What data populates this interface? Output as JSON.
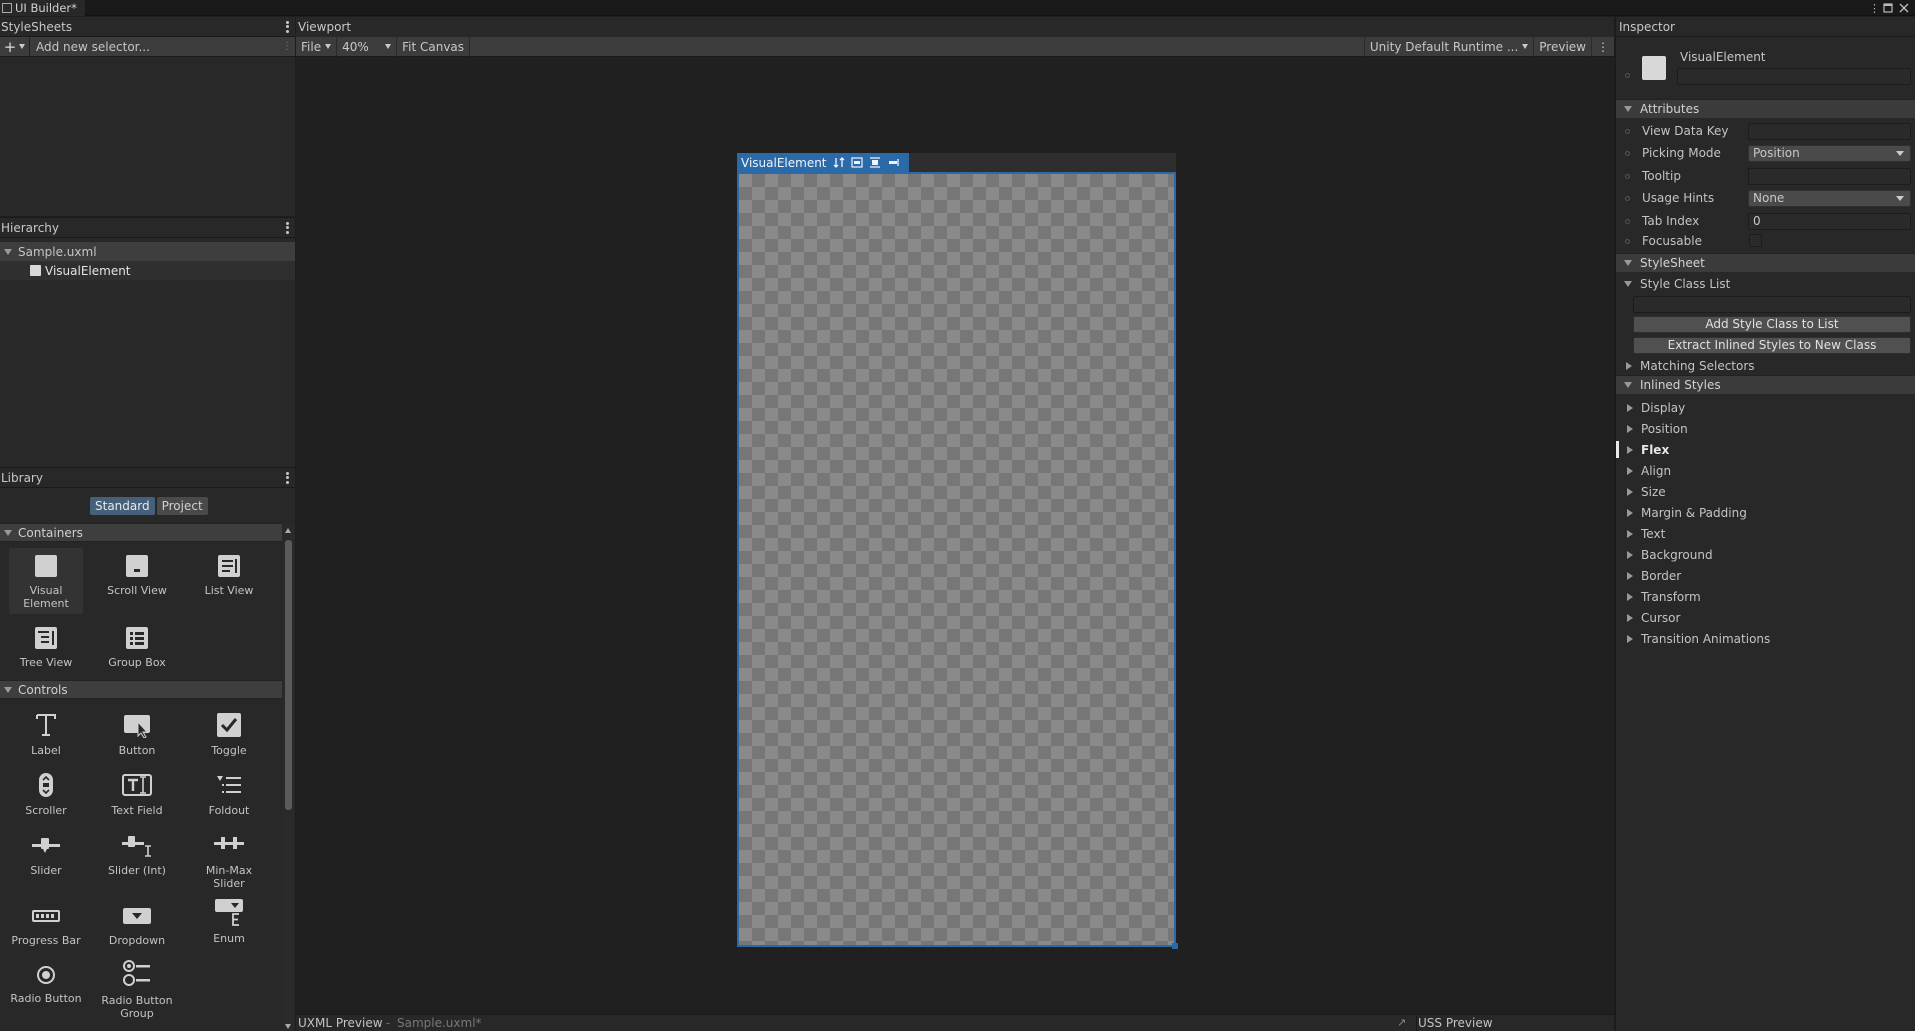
{
  "window": {
    "title": "UI Builder*"
  },
  "stylesheets": {
    "title": "StyleSheets",
    "add_selector_placeholder": "Add new selector..."
  },
  "hierarchy": {
    "title": "Hierarchy",
    "file": "Sample.uxml",
    "element": "VisualElement"
  },
  "library": {
    "title": "Library",
    "tabs": [
      "Standard",
      "Project"
    ],
    "sections": {
      "containers": "Containers",
      "controls": "Controls"
    },
    "containers": [
      {
        "label": "Visual\nElement",
        "icon": "visual-element-icon"
      },
      {
        "label": "Scroll View",
        "icon": "scroll-view-icon"
      },
      {
        "label": "List View",
        "icon": "list-view-icon"
      },
      {
        "label": "Tree View",
        "icon": "tree-view-icon"
      },
      {
        "label": "Group Box",
        "icon": "group-box-icon"
      }
    ],
    "controls": [
      {
        "label": "Label",
        "icon": "label-icon"
      },
      {
        "label": "Button",
        "icon": "button-icon"
      },
      {
        "label": "Toggle",
        "icon": "toggle-icon"
      },
      {
        "label": "Scroller",
        "icon": "scroller-icon"
      },
      {
        "label": "Text Field",
        "icon": "text-field-icon"
      },
      {
        "label": "Foldout",
        "icon": "foldout-icon"
      },
      {
        "label": "Slider",
        "icon": "slider-icon"
      },
      {
        "label": "Slider (Int)",
        "icon": "slider-int-icon"
      },
      {
        "label": "Min-Max\nSlider",
        "icon": "min-max-slider-icon"
      },
      {
        "label": "Progress Bar",
        "icon": "progress-bar-icon"
      },
      {
        "label": "Dropdown",
        "icon": "dropdown-icon"
      },
      {
        "label": "Enum",
        "icon": "enum-icon"
      },
      {
        "label": "Radio Button",
        "icon": "radio-button-icon"
      },
      {
        "label": "Radio Button\nGroup",
        "icon": "radio-button-group-icon"
      }
    ]
  },
  "viewport": {
    "title": "Viewport",
    "file_menu": "File",
    "zoom": "40%",
    "fit_canvas": "Fit Canvas",
    "theme": "Unity Default Runtime ...",
    "preview": "Preview",
    "canvas_element": "VisualElement",
    "uxml_preview": "UXML Preview",
    "uxml_file": "Sample.uxml*",
    "uss_preview": "USS Preview"
  },
  "inspector": {
    "title": "Inspector",
    "element_type": "VisualElement",
    "attributes": {
      "title": "Attributes",
      "view_data_key": {
        "label": "View Data Key",
        "value": ""
      },
      "picking_mode": {
        "label": "Picking Mode",
        "value": "Position"
      },
      "tooltip": {
        "label": "Tooltip",
        "value": ""
      },
      "usage_hints": {
        "label": "Usage Hints",
        "value": "None"
      },
      "tab_index": {
        "label": "Tab Index",
        "value": "0"
      },
      "focusable": {
        "label": "Focusable"
      }
    },
    "stylesheet": {
      "title": "StyleSheet",
      "style_class_list": "Style Class List",
      "add_class_btn": "Add Style Class to List",
      "extract_btn": "Extract Inlined Styles to New Class",
      "matching_selectors": "Matching Selectors"
    },
    "inlined_styles": {
      "title": "Inlined Styles",
      "groups": [
        "Display",
        "Position",
        "Flex",
        "Align",
        "Size",
        "Margin & Padding",
        "Text",
        "Background",
        "Border",
        "Transform",
        "Cursor",
        "Transition Animations"
      ],
      "overridden": "Flex"
    }
  },
  "colors": {
    "accent": "#2b6aa9",
    "panel": "#282828",
    "viewport": "#202020"
  }
}
